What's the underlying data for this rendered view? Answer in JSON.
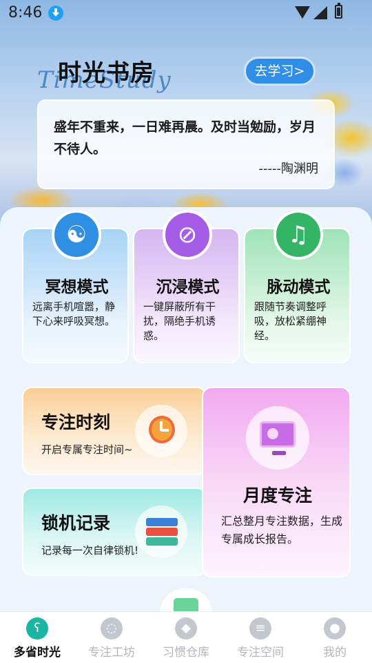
{
  "status_bar": {
    "time": "8:46",
    "icons": [
      "download-icon",
      "wifi-icon",
      "signal-icon",
      "battery-icon"
    ]
  },
  "header": {
    "title": "时光书房",
    "script": "TimeStudy",
    "learn_button": "去学习>"
  },
  "quote": {
    "text": "盛年不重来，一日难再晨。及时当勉励，岁月不待人。",
    "author": "-----陶渊明"
  },
  "modes": [
    {
      "title": "冥想模式",
      "desc": "远离手机喧嚣，静下心来呼吸冥想。",
      "icon": "meditation-icon",
      "color": "#2e8fe3"
    },
    {
      "title": "沉浸模式",
      "desc": "一键屏蔽所有干扰，隔绝手机诱惑。",
      "icon": "user-block-icon",
      "color": "#a45be6"
    },
    {
      "title": "脉动模式",
      "desc": "跟随节奏调整呼吸，放松紧绷神经。",
      "icon": "music-note-icon",
      "color": "#34b565"
    }
  ],
  "features": {
    "focus": {
      "title": "专注时刻",
      "desc": "开启专属专注时间~",
      "icon": "alarm-clock-icon"
    },
    "lock": {
      "title": "锁机记录",
      "desc": "记录每一次自律锁机!",
      "icon": "books-icon"
    },
    "month": {
      "title": "月度专注",
      "desc": "汇总整月专注数据，生成专属成长报告。",
      "icon": "monitor-chart-icon"
    }
  },
  "bottom_nav": [
    {
      "label": "多省时光",
      "icon": "bear-icon",
      "active": true
    },
    {
      "label": "专注工坊",
      "icon": "bulb-icon",
      "active": false
    },
    {
      "label": "习惯仓库",
      "icon": "box-icon",
      "active": false
    },
    {
      "label": "专注空间",
      "icon": "layers-icon",
      "active": false
    },
    {
      "label": "我的",
      "icon": "person-icon",
      "active": false
    }
  ]
}
